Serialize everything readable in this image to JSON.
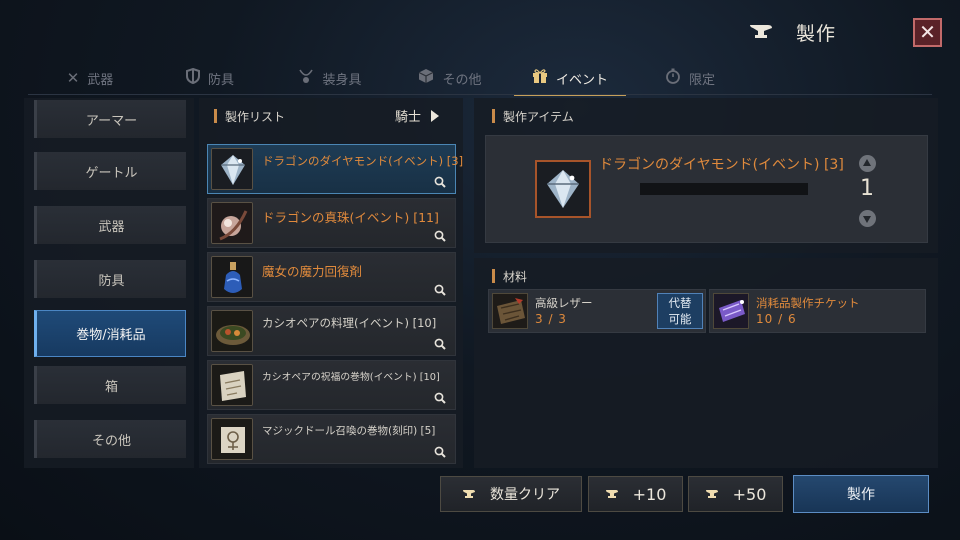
{
  "header": {
    "title": "製作",
    "icon": "anvil-icon",
    "close_label": "✕"
  },
  "tabs": [
    {
      "label": "武器",
      "icon": "swords-icon",
      "active": false
    },
    {
      "label": "防具",
      "icon": "shield-icon",
      "active": false
    },
    {
      "label": "装身具",
      "icon": "necklace-icon",
      "active": false
    },
    {
      "label": "その他",
      "icon": "box-icon",
      "active": false
    },
    {
      "label": "イベント",
      "icon": "gift-icon",
      "active": true
    },
    {
      "label": "限定",
      "icon": "stopwatch-icon",
      "active": false
    }
  ],
  "categories": [
    {
      "label": "アーマー",
      "active": false
    },
    {
      "label": "ゲートル",
      "active": false
    },
    {
      "label": "武器",
      "active": false
    },
    {
      "label": "防具",
      "active": false
    },
    {
      "label": "巻物/消耗品",
      "active": true
    },
    {
      "label": "箱",
      "active": false
    },
    {
      "label": "その他",
      "active": false
    }
  ],
  "craft_list": {
    "title": "製作リスト",
    "class_label": "騎士",
    "items": [
      {
        "name": "ドラゴンのダイヤモンド(イベント) [3]",
        "icon": "dragon-diamond-icon",
        "selected": true
      },
      {
        "name": "ドラゴンの真珠(イベント) [11]",
        "icon": "dragon-pearl-icon",
        "selected": false
      },
      {
        "name": "魔女の魔力回復剤",
        "icon": "potion-icon",
        "selected": false
      },
      {
        "name": "カシオペアの料理(イベント) [10]",
        "icon": "dish-icon",
        "selected": false
      },
      {
        "name": "カシオペアの祝福の巻物(イベント) [10]",
        "icon": "scroll-icon",
        "selected": false
      },
      {
        "name": "マジックドール召喚の巻物(刻印) [5]",
        "icon": "doll-scroll-icon",
        "selected": false
      }
    ]
  },
  "craft_item": {
    "title": "製作アイテム",
    "name": "ドラゴンのダイヤモンド(イベント) [3]",
    "quantity": "1"
  },
  "materials": {
    "title": "材料",
    "items": [
      {
        "name": "高級レザー",
        "count": "3 / 3",
        "icon": "leather-icon",
        "name_color": "#d6d2ca",
        "substitute_label_1": "代替",
        "substitute_label_2": "可能"
      },
      {
        "name": "消耗品製作チケット",
        "count": "10 / 6",
        "icon": "ticket-icon",
        "name_color": "#e08a3c"
      }
    ]
  },
  "buttons": {
    "clear": "数量クリア",
    "plus10": "+10",
    "plus50": "+50",
    "craft": "製作"
  },
  "colors": {
    "accent_orange": "#e08a3c",
    "active_blue": "#1f4a78",
    "close_red": "#5a2228"
  }
}
